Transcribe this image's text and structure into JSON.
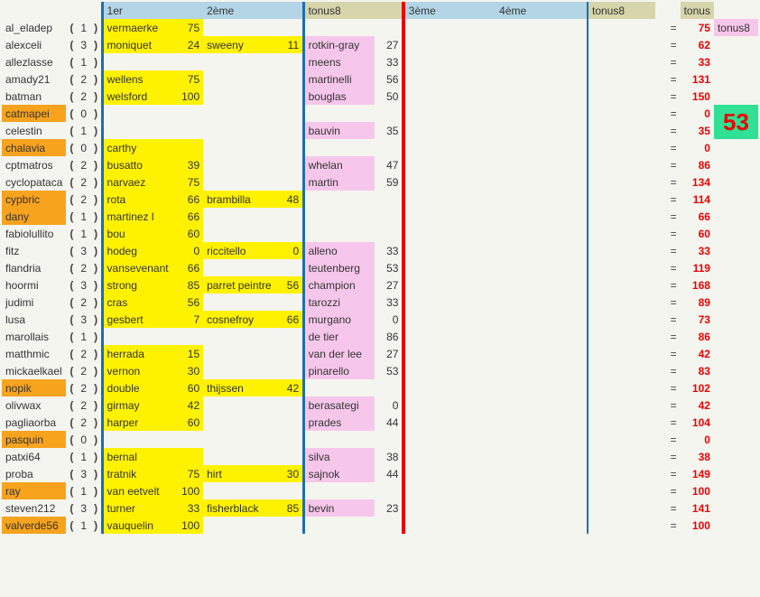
{
  "headers": {
    "c1": "1er",
    "c2": "2ème",
    "c3": "tonus8",
    "c4": "3ème",
    "c5": "4ème",
    "c6": "tonus8",
    "tot": "tonus",
    "side": "tonus8"
  },
  "big_number": "53",
  "rows": [
    {
      "player": "al_eladep",
      "hl": false,
      "n": "1",
      "r1": "vermaerke",
      "p1": "75",
      "r2": "",
      "p2": "",
      "r3": "",
      "p3": "",
      "tot": "75"
    },
    {
      "player": "alexceli",
      "hl": false,
      "n": "3",
      "r1": "moniquet",
      "p1": "24",
      "r2": "sweeny",
      "p2": "11",
      "r3": "rotkin-gray",
      "p3": "27",
      "tot": "62"
    },
    {
      "player": "allezlasse",
      "hl": false,
      "n": "1",
      "r1": "",
      "p1": "",
      "r2": "",
      "p2": "",
      "r3": "meens",
      "p3": "33",
      "tot": "33"
    },
    {
      "player": "amady21",
      "hl": false,
      "n": "2",
      "r1": "wellens",
      "p1": "75",
      "r2": "",
      "p2": "",
      "r3": "martinelli",
      "p3": "56",
      "tot": "131"
    },
    {
      "player": "batman",
      "hl": false,
      "n": "2",
      "r1": "welsford",
      "p1": "100",
      "r2": "",
      "p2": "",
      "r3": "bouglas",
      "p3": "50",
      "tot": "150"
    },
    {
      "player": "catmapei",
      "hl": true,
      "n": "0",
      "r1": "",
      "p1": "",
      "r2": "",
      "p2": "",
      "r3": "",
      "p3": "",
      "tot": "0"
    },
    {
      "player": "celestin",
      "hl": false,
      "n": "1",
      "r1": "",
      "p1": "",
      "r2": "",
      "p2": "",
      "r3": "bauvin",
      "p3": "35",
      "tot": "35"
    },
    {
      "player": "chalavia",
      "hl": true,
      "n": "0",
      "r1": "carthy",
      "p1": "",
      "r2": "",
      "p2": "",
      "r3": "",
      "p3": "",
      "tot": "0"
    },
    {
      "player": "cptmatros",
      "hl": false,
      "n": "2",
      "r1": "busatto",
      "p1": "39",
      "r2": "",
      "p2": "",
      "r3": "whelan",
      "p3": "47",
      "tot": "86"
    },
    {
      "player": "cyclopataca",
      "hl": false,
      "n": "2",
      "r1": "narvaez",
      "p1": "75",
      "r2": "",
      "p2": "",
      "r3": "martin",
      "p3": "59",
      "tot": "134"
    },
    {
      "player": "cypbric",
      "hl": true,
      "n": "2",
      "r1": "rota",
      "p1": "66",
      "r2": "brambilla",
      "p2": "48",
      "r3": "",
      "p3": "",
      "tot": "114"
    },
    {
      "player": "dany",
      "hl": true,
      "n": "1",
      "r1": "martinez l",
      "p1": "66",
      "r2": "",
      "p2": "",
      "r3": "",
      "p3": "",
      "tot": "66"
    },
    {
      "player": "fabiolullito",
      "hl": false,
      "n": "1",
      "r1": "bou",
      "p1": "60",
      "r2": "",
      "p2": "",
      "r3": "",
      "p3": "",
      "tot": "60"
    },
    {
      "player": "fitz",
      "hl": false,
      "n": "3",
      "r1": "hodeg",
      "p1": "0",
      "r2": "riccitello",
      "p2": "0",
      "r3": "alleno",
      "p3": "33",
      "tot": "33"
    },
    {
      "player": "flandria",
      "hl": false,
      "n": "2",
      "r1": "vansevenant",
      "p1": "66",
      "r2": "",
      "p2": "",
      "r3": "teutenberg",
      "p3": "53",
      "tot": "119"
    },
    {
      "player": "hoormi",
      "hl": false,
      "n": "3",
      "r1": "strong",
      "p1": "85",
      "r2": "parret peintre",
      "p2": "56",
      "r3": "champion",
      "p3": "27",
      "tot": "168"
    },
    {
      "player": "judimi",
      "hl": false,
      "n": "2",
      "r1": "cras",
      "p1": "56",
      "r2": "",
      "p2": "",
      "r3": "tarozzi",
      "p3": "33",
      "tot": "89"
    },
    {
      "player": "lusa",
      "hl": false,
      "n": "3",
      "r1": "gesbert",
      "p1": "7",
      "r2": "cosnefroy",
      "p2": "66",
      "r3": "murgano",
      "p3": "0",
      "tot": "73"
    },
    {
      "player": "marollais",
      "hl": false,
      "n": "1",
      "r1": "",
      "p1": "",
      "r2": "",
      "p2": "",
      "r3": "de tier",
      "p3": "86",
      "tot": "86"
    },
    {
      "player": "matthmic",
      "hl": false,
      "n": "2",
      "r1": "herrada",
      "p1": "15",
      "r2": "",
      "p2": "",
      "r3": "van der lee",
      "p3": "27",
      "tot": "42"
    },
    {
      "player": "mickaelkael",
      "hl": false,
      "n": "2",
      "r1": "vernon",
      "p1": "30",
      "r2": "",
      "p2": "",
      "r3": "pinarello",
      "p3": "53",
      "tot": "83"
    },
    {
      "player": "nopik",
      "hl": true,
      "n": "2",
      "r1": "double",
      "p1": "60",
      "r2": "thijssen",
      "p2": "42",
      "r3": "",
      "p3": "",
      "tot": "102"
    },
    {
      "player": "olivwax",
      "hl": false,
      "n": "2",
      "r1": "girmay",
      "p1": "42",
      "r2": "",
      "p2": "",
      "r3": "berasategi",
      "p3": "0",
      "tot": "42"
    },
    {
      "player": "pagliaorba",
      "hl": false,
      "n": "2",
      "r1": "harper",
      "p1": "60",
      "r2": "",
      "p2": "",
      "r3": "prades",
      "p3": "44",
      "tot": "104"
    },
    {
      "player": "pasquin",
      "hl": true,
      "n": "0",
      "r1": "",
      "p1": "",
      "r2": "",
      "p2": "",
      "r3": "",
      "p3": "",
      "tot": "0"
    },
    {
      "player": "patxi64",
      "hl": false,
      "n": "1",
      "r1": "bernal",
      "p1": "",
      "r2": "",
      "p2": "",
      "r3": "silva",
      "p3": "38",
      "tot": "38"
    },
    {
      "player": "proba",
      "hl": false,
      "n": "3",
      "r1": "tratnik",
      "p1": "75",
      "r2": "hirt",
      "p2": "30",
      "r3": "sajnok",
      "p3": "44",
      "tot": "149"
    },
    {
      "player": "ray",
      "hl": true,
      "n": "1",
      "r1": "van eetvelt",
      "p1": "100",
      "r2": "",
      "p2": "",
      "r3": "",
      "p3": "",
      "tot": "100"
    },
    {
      "player": "steven212",
      "hl": false,
      "n": "3",
      "r1": "turner",
      "p1": "33",
      "r2": "fisherblack",
      "p2": "85",
      "r3": "bevin",
      "p3": "23",
      "tot": "141"
    },
    {
      "player": "valverde56",
      "hl": true,
      "n": "1",
      "r1": "vauquelin",
      "p1": "100",
      "r2": "",
      "p2": "",
      "r3": "",
      "p3": "",
      "tot": "100"
    }
  ]
}
